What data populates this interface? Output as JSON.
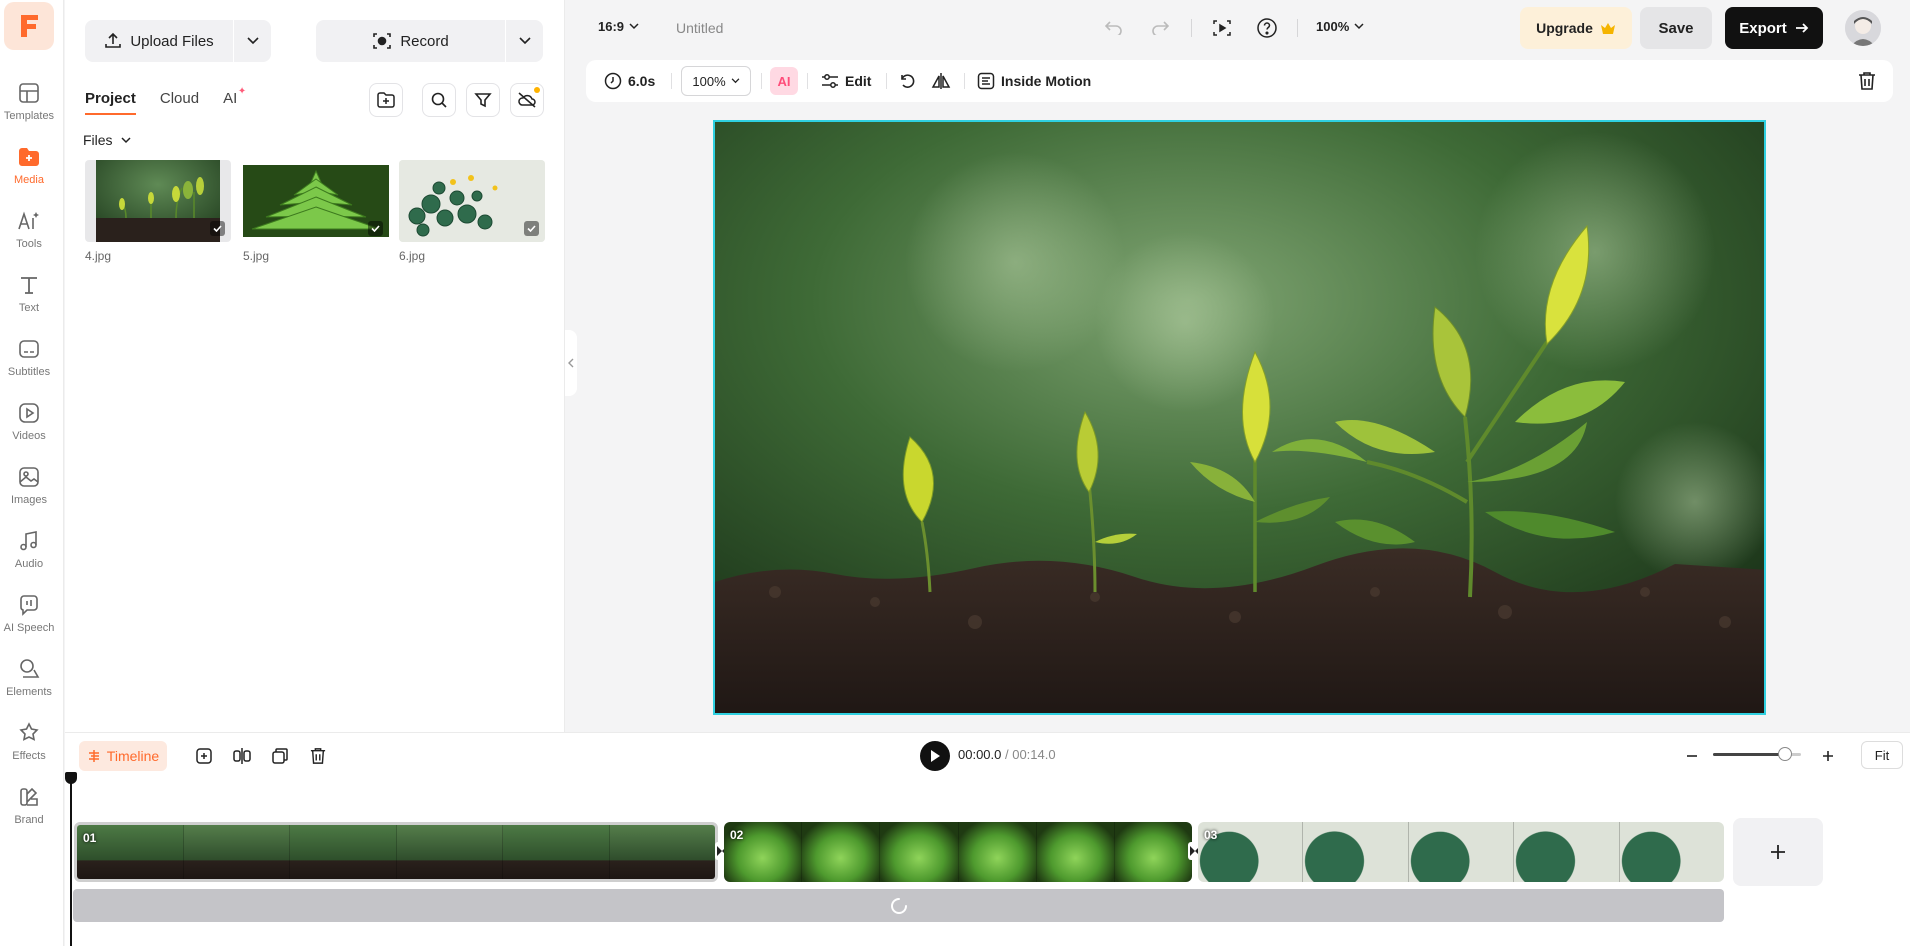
{
  "nav": [
    {
      "key": "templates",
      "label": "Templates",
      "icon": "templates-icon"
    },
    {
      "key": "media",
      "label": "Media",
      "icon": "media-icon",
      "active": true
    },
    {
      "key": "tools",
      "label": "Tools",
      "icon": "ai-tools-icon"
    },
    {
      "key": "text",
      "label": "Text",
      "icon": "text-icon"
    },
    {
      "key": "subtitles",
      "label": "Subtitles",
      "icon": "subtitles-icon"
    },
    {
      "key": "videos",
      "label": "Videos",
      "icon": "videos-icon"
    },
    {
      "key": "images",
      "label": "Images",
      "icon": "images-icon"
    },
    {
      "key": "audio",
      "label": "Audio",
      "icon": "audio-icon"
    },
    {
      "key": "ai_speech",
      "label": "AI Speech",
      "icon": "ai-speech-icon"
    },
    {
      "key": "elements",
      "label": "Elements",
      "icon": "elements-icon"
    },
    {
      "key": "effects",
      "label": "Effects",
      "icon": "effects-icon"
    },
    {
      "key": "brand",
      "label": "Brand",
      "icon": "brand-icon"
    }
  ],
  "media_panel": {
    "upload_label": "Upload Files",
    "record_label": "Record",
    "tabs": [
      {
        "label": "Project",
        "active": true
      },
      {
        "label": "Cloud",
        "active": false
      },
      {
        "label": "AI",
        "active": false
      }
    ],
    "files_label": "Files",
    "files": [
      {
        "name": "4.jpg",
        "kind": "seedlings"
      },
      {
        "name": "5.jpg",
        "kind": "succulent"
      },
      {
        "name": "6.jpg",
        "kind": "plant-buttons"
      }
    ]
  },
  "topbar": {
    "aspect_ratio": "16:9",
    "project_title": "Untitled",
    "zoom": "100%",
    "upgrade_label": "Upgrade",
    "save_label": "Save",
    "export_label": "Export"
  },
  "prop_toolbar": {
    "duration": "6.0s",
    "scale": "100%",
    "ai_label": "AI",
    "edit_label": "Edit",
    "motion_label": "Inside Motion"
  },
  "timeline": {
    "label": "Timeline",
    "current_time": "00:00.0",
    "separator": " / ",
    "total_time": "00:14.0",
    "fit_label": "Fit",
    "zoom_level": 0.82,
    "clips": [
      {
        "label": "01",
        "kind": "seedlings",
        "selected": true
      },
      {
        "label": "02",
        "kind": "succulent",
        "selected": false
      },
      {
        "label": "03",
        "kind": "plant-buttons",
        "selected": false
      }
    ]
  },
  "colors": {
    "accent": "#ff6a2c",
    "selection": "#2fd0e0",
    "export_bg": "#111111",
    "upgrade_bg": "#fdf0d9"
  }
}
